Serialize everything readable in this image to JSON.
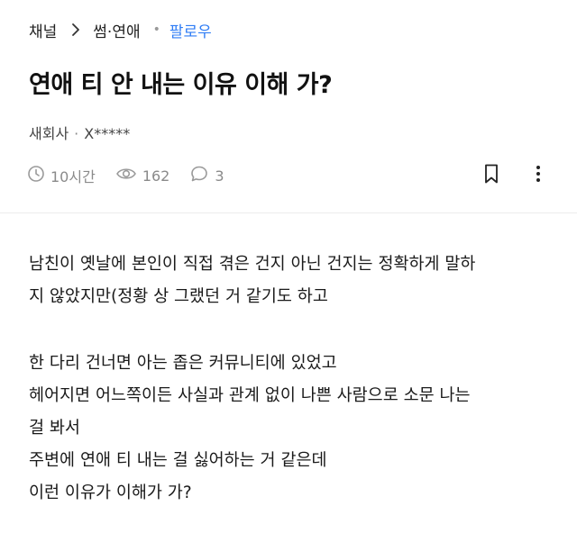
{
  "breadcrumb": {
    "root": "채널",
    "category": "썸·연애",
    "follow": "팔로우"
  },
  "post": {
    "title": "연애 티 안 내는 이유 이해 가?",
    "company": "새회사",
    "author_separator": "·",
    "author": "X*****",
    "time": "10시간",
    "views": "162",
    "comments": "3",
    "body": {
      "paragraph1": [
        "남친이 옛날에 본인이 직접 겪은 건지 아닌 건지는 정확하게 말하",
        "지 않았지만(정황 상 그랬던 거 같기도 하고"
      ],
      "paragraph2": [
        "한 다리 건너면 아는 좁은 커뮤니티에 있었고",
        "헤어지면 어느쪽이든 사실과 관계 없이 나쁜 사람으로 소문 나는",
        "걸 봐서",
        "주변에 연애 티 내는 걸 싫어하는 거 같은데",
        "이런 이유가 이해가 가?"
      ]
    }
  },
  "icons": {
    "chevron": "chevron-right-icon",
    "clock": "clock-icon",
    "eye": "eye-icon",
    "comment": "comment-icon",
    "bookmark": "bookmark-icon",
    "more": "more-vertical-icon"
  },
  "colors": {
    "accent": "#2f7df5",
    "meta": "#8a8a8a"
  }
}
